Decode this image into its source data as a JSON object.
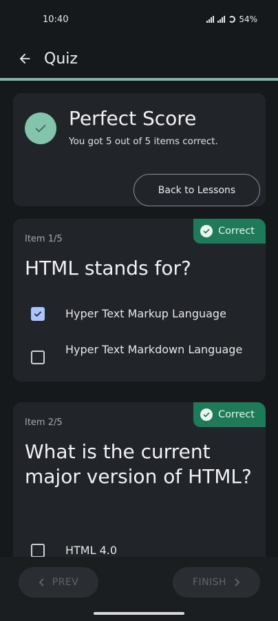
{
  "status_bar": {
    "time": "10:40",
    "battery": "54%"
  },
  "app_bar": {
    "title": "Quiz",
    "back_icon": "arrow-left-icon"
  },
  "colors": {
    "accent": "#7fb7a3",
    "correct_badge": "#1f7a5a",
    "checkbox_checked": "#a9c4ff"
  },
  "summary": {
    "title": "Perfect Score",
    "subtitle": "You got 5 out of 5 items correct.",
    "back_button": "Back to Lessons"
  },
  "questions": [
    {
      "item_label": "Item 1/5",
      "badge": "Correct",
      "question": "HTML stands for?",
      "options": [
        {
          "text": "Hyper Text Markup Language",
          "checked": true
        },
        {
          "text": "Hyper Text Markdown Language",
          "checked": false
        }
      ]
    },
    {
      "item_label": "Item 2/5",
      "badge": "Correct",
      "question": "What is the current major version of HTML?",
      "options": [
        {
          "text": "HTML 4.0",
          "checked": false
        }
      ]
    }
  ],
  "nav": {
    "prev": "PREV",
    "finish": "FINISH"
  }
}
